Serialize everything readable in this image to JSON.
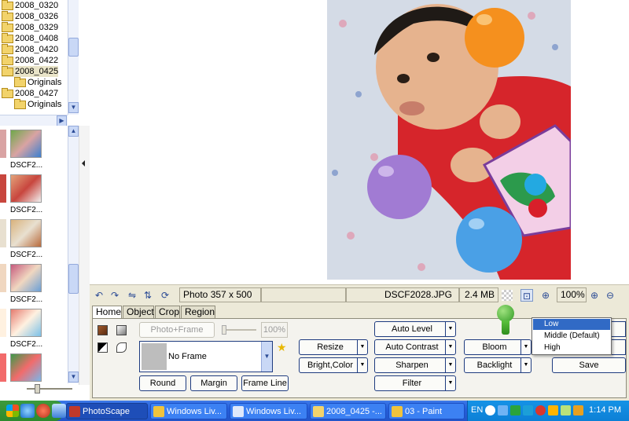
{
  "tree": {
    "items": [
      {
        "label": "2008_0320",
        "indent": 0
      },
      {
        "label": "2008_0326",
        "indent": 0
      },
      {
        "label": "2008_0329",
        "indent": 0
      },
      {
        "label": "2008_0408",
        "indent": 0
      },
      {
        "label": "2008_0420",
        "indent": 0
      },
      {
        "label": "2008_0422",
        "indent": 0
      },
      {
        "label": "2008_0425",
        "indent": 0,
        "selected": true
      },
      {
        "label": "Originals",
        "indent": 1
      },
      {
        "label": "2008_0427",
        "indent": 0
      },
      {
        "label": "Originals",
        "indent": 1
      }
    ]
  },
  "thumbnails": {
    "label": "DSCF2..."
  },
  "status": {
    "photo_info": "Photo 357 x 500",
    "filename": "DSCF2028.JPG",
    "filesize": "2.4 MB",
    "zoom": "100%"
  },
  "editor": {
    "tabs": [
      "Home",
      "Object",
      "Crop",
      "Region"
    ],
    "active_tab": "Home",
    "photo_frame": "Photo+Frame",
    "frame_percent": "100%",
    "frame_name": "No Frame",
    "round": "Round",
    "margin": "Margin",
    "frame_line": "Frame Line",
    "resize": "Resize",
    "bright_color": "Bright,Color",
    "auto_level": "Auto Level",
    "auto_contrast": "Auto Contrast",
    "sharpen": "Sharpen",
    "filter": "Filter",
    "bloom": "Bloom",
    "backlight": "Backlight",
    "save": "Save"
  },
  "bloom_menu": {
    "items": [
      "Low",
      "Middle (Default)",
      "High"
    ],
    "selected": "Low"
  },
  "taskbar": {
    "tasks": [
      {
        "label": "PhotoScape",
        "active": true,
        "icon_color": "#c0392b"
      },
      {
        "label": "Windows Liv...",
        "active": false,
        "icon_color": "#f0c33c"
      },
      {
        "label": "Windows Liv...",
        "active": false,
        "icon_color": "#dfe9fb"
      },
      {
        "label": "2008_0425 -...",
        "active": false,
        "icon_color": "#f2d36b"
      },
      {
        "label": "03 - Paint",
        "active": false,
        "icon_color": "#f0c33c"
      }
    ],
    "language": "EN",
    "clock": "1:14 PM"
  },
  "colors": {
    "taskbar_blue": "#245edb",
    "tray_blue": "#0c80d6",
    "menu_highlight": "#316ac5",
    "panel_bg": "#ece9d8"
  }
}
